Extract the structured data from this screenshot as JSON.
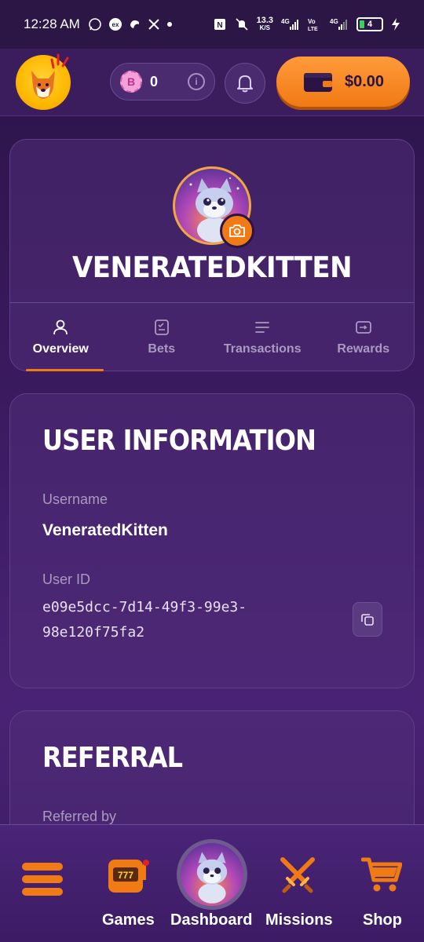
{
  "status_bar": {
    "time": "12:28 AM",
    "net_speed_value": "13.3",
    "net_speed_unit": "K/S",
    "battery_level": "4",
    "icons": [
      "whatsapp-icon",
      "ex-icon",
      "app-icon",
      "x-icon",
      "dot-icon",
      "nfc-icon",
      "mute-icon",
      "signal-4g-icon",
      "volte-icon",
      "signal-4g-icon",
      "battery-icon",
      "charging-icon"
    ]
  },
  "header": {
    "points_icon_letter": "B",
    "points_value": "0",
    "wallet_amount": "$0.00"
  },
  "profile": {
    "username": "VENERATEDKITTEN",
    "tabs": [
      {
        "label": "Overview",
        "icon": "user-icon",
        "active": true
      },
      {
        "label": "Bets",
        "icon": "bets-icon",
        "active": false
      },
      {
        "label": "Transactions",
        "icon": "list-icon",
        "active": false
      },
      {
        "label": "Rewards",
        "icon": "rewards-icon",
        "active": false
      }
    ]
  },
  "user_information": {
    "title": "USER INFORMATION",
    "username_label": "Username",
    "username_value": "VeneratedKitten",
    "user_id_label": "User ID",
    "user_id_line1": "e09e5dcc-7d14-49f3-99e3-",
    "user_id_line2": "98e120f75fa2"
  },
  "referral": {
    "title": "REFERRAL",
    "referred_by_label": "Referred by"
  },
  "bottom_nav": {
    "items": [
      {
        "label": "",
        "icon": "menu-icon"
      },
      {
        "label": "Games",
        "icon": "slot-machine-icon"
      },
      {
        "label": "Dashboard",
        "icon": "avatar"
      },
      {
        "label": "Missions",
        "icon": "swords-icon"
      },
      {
        "label": "Shop",
        "icon": "cart-icon"
      }
    ]
  },
  "colors": {
    "accent": "#f07a14",
    "background": "#3a1a5e",
    "muted_text": "#a99ac0"
  }
}
